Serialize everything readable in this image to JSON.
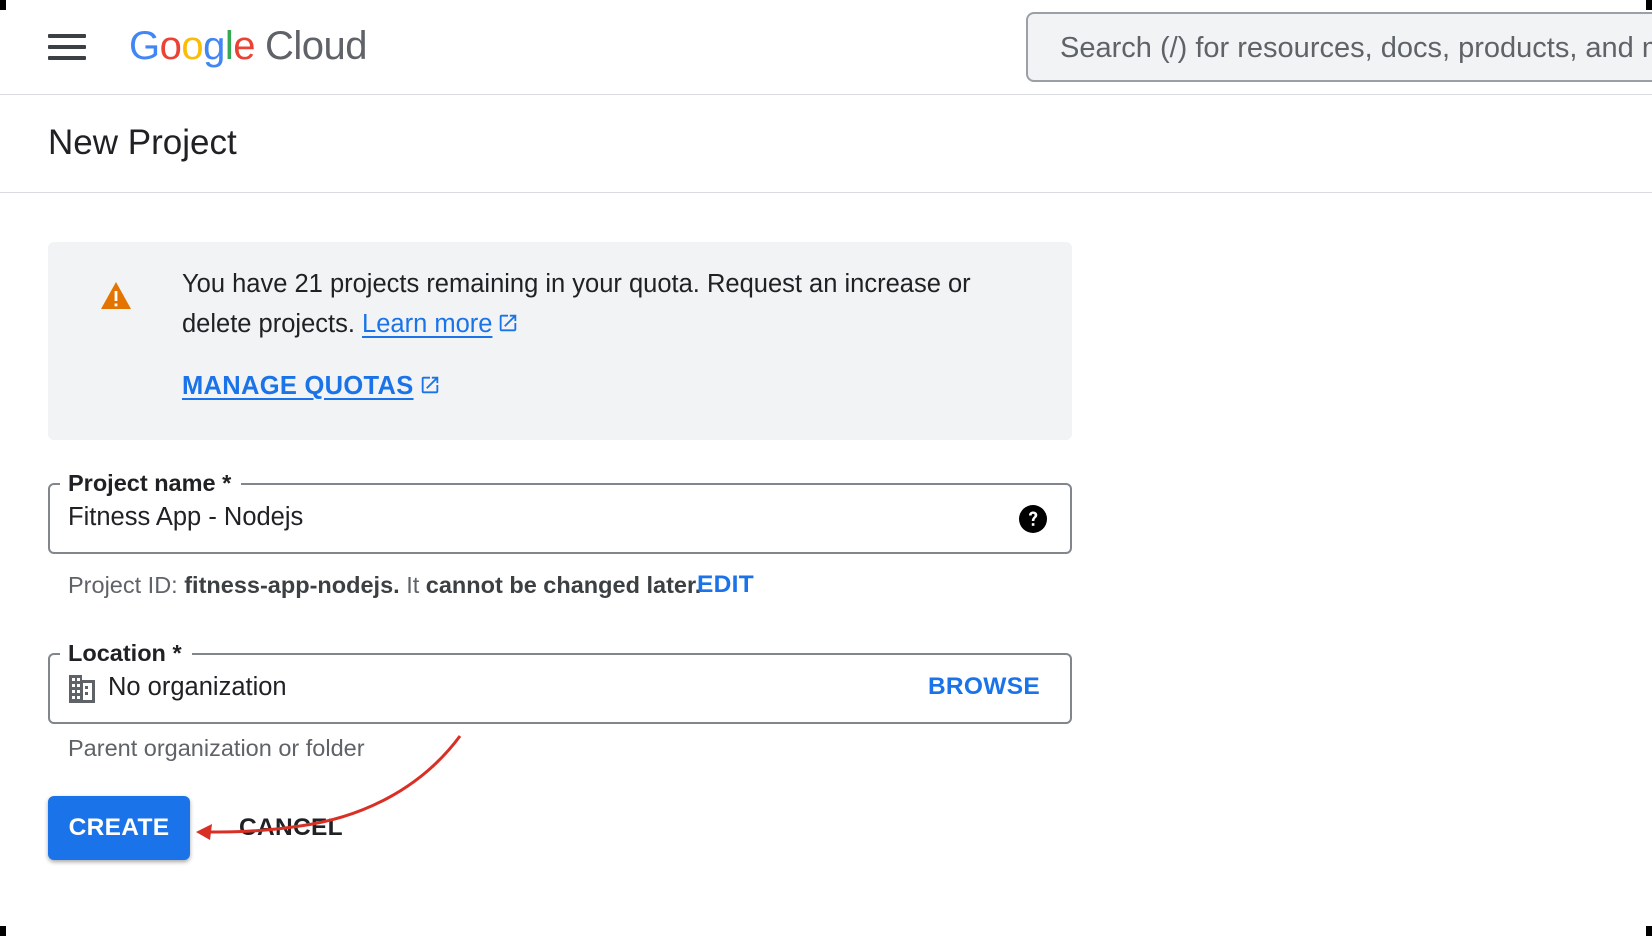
{
  "header": {
    "logo_google": "Google",
    "logo_cloud": "Cloud",
    "search_placeholder": "Search (/) for resources, docs, products, and more"
  },
  "page": {
    "title": "New Project"
  },
  "notice": {
    "text_prefix": "You have 21 projects remaining in your quota. Request an increase or delete projects.",
    "learn_more": "Learn more",
    "manage_quotas": "MANAGE QUOTAS"
  },
  "project_name": {
    "label": "Project name *",
    "value": "Fitness App - Nodejs"
  },
  "project_id": {
    "prefix": "Project ID:",
    "id": "fitness-app-nodejs.",
    "mid": "It",
    "suffix": "cannot be changed later.",
    "edit": "EDIT"
  },
  "location": {
    "label": "Location *",
    "value": "No organization",
    "browse": "BROWSE",
    "hint": "Parent organization or folder"
  },
  "actions": {
    "create": "CREATE",
    "cancel": "CANCEL"
  },
  "colors": {
    "accent": "#1a73e8",
    "warning": "#e37400",
    "annotation_arrow": "#d93025"
  },
  "icons": [
    "menu-icon",
    "warning-icon",
    "external-link-icon",
    "help-icon",
    "building-icon"
  ]
}
